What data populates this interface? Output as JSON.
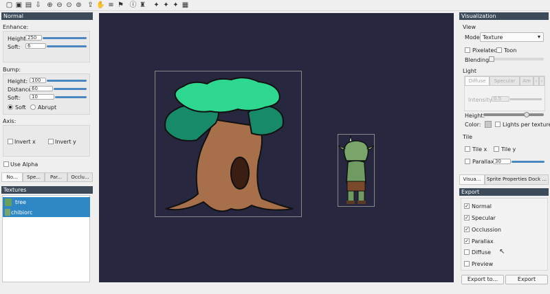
{
  "toolbar": {
    "icons": [
      "new-file-icon",
      "save-icon",
      "save-as-icon",
      "export-icon",
      "zoom-in-icon",
      "zoom-out-icon",
      "zoom-reset-icon",
      "zoom-fit-icon",
      "share-icon",
      "hand-icon",
      "sliders-icon",
      "flag-icon",
      "info-icon",
      "shirt-icon",
      "puzzle-icon",
      "puzzle-alt-icon",
      "puzzle-gear-icon",
      "grid-icon"
    ]
  },
  "left": {
    "title": "Normal",
    "enhance": {
      "label": "Enhance:",
      "height_label": "Height:",
      "height_value": "250",
      "soft_label": "Soft:",
      "soft_value": "6"
    },
    "bump": {
      "label": "Bump:",
      "height_label": "Height:",
      "height_value": "100",
      "distance_label": "Distance:",
      "distance_value": "60",
      "soft_label": "Soft:",
      "soft_value": "10",
      "radio_soft": "Soft",
      "radio_abrupt": "Abrupt"
    },
    "axis": {
      "label": "Axis:",
      "invert_x": "Invert x",
      "invert_y": "Invert y"
    },
    "use_alpha": "Use Alpha",
    "tabs": [
      "No...",
      "Spe...",
      "Par...",
      "Occlu..."
    ]
  },
  "textures": {
    "title": "Textures",
    "items": [
      "tree",
      "chibiorc"
    ]
  },
  "right": {
    "title": "Visualization",
    "view": {
      "label": "View",
      "mode_label": "Mode:",
      "mode_value": "Texture",
      "pixelated": "Pixelated",
      "toon": "Toon",
      "blending": "Blending:"
    },
    "light": {
      "label": "Light",
      "tabs": [
        "Diffuse",
        "Specular",
        "Am"
      ],
      "intensity_label": "Intensity:",
      "intensity_value": "0.5",
      "height_label": "Height:",
      "color_label": "Color:",
      "lights_per_texture": "Lights per texture"
    },
    "tile": {
      "label": "Tile",
      "tile_x": "Tile x",
      "tile_y": "Tile y",
      "parallax": "Parallax",
      "parallax_value": "30"
    },
    "dock_tabs": [
      "Visua...",
      "Sprite Properties Dock ..."
    ]
  },
  "export": {
    "title": "Export",
    "items": [
      {
        "label": "Normal",
        "checked": "✓"
      },
      {
        "label": "Specular",
        "checked": "✓"
      },
      {
        "label": "Occlussion",
        "checked": "✓"
      },
      {
        "label": "Parallax",
        "checked": "✓"
      },
      {
        "label": "Diffuse",
        "checked": ""
      },
      {
        "label": "Preview",
        "checked": ""
      }
    ],
    "export_to": "Export to...",
    "export": "Export"
  },
  "colors": {
    "canvas_bg": "#272740",
    "dock_title": "#3c4a5a",
    "selection": "#2f86c4",
    "accent": "#4a86c0"
  }
}
